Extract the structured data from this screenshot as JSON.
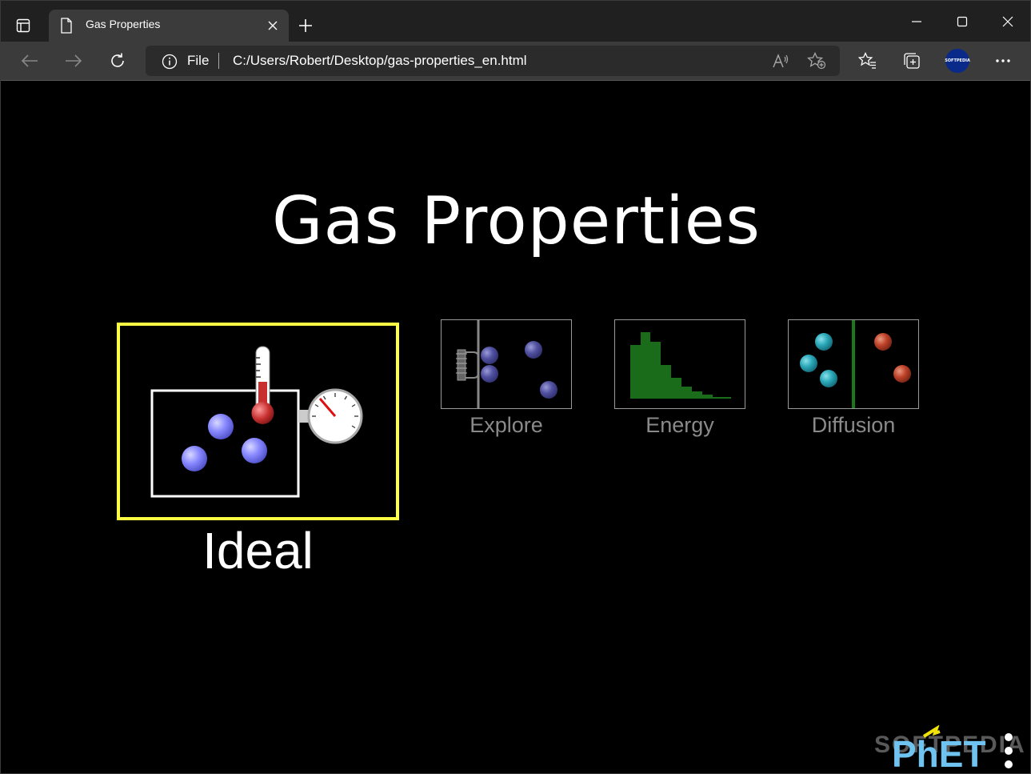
{
  "browser": {
    "tab_title": "Gas Properties",
    "address_prefix": "File",
    "url": "C:/Users/Robert/Desktop/gas-properties_en.html",
    "profile_label": "SOFTPEDIA"
  },
  "sim": {
    "title": "Gas Properties",
    "screens": [
      {
        "label": "Ideal",
        "selected": true
      },
      {
        "label": "Explore",
        "selected": false
      },
      {
        "label": "Energy",
        "selected": false
      },
      {
        "label": "Diffusion",
        "selected": false
      }
    ],
    "logo_text": "PhET",
    "watermark": "SOFTPEDIA"
  },
  "colors": {
    "selection_border": "#ffff44",
    "particle_heavy": "#8888ff",
    "histogram": "#1a6b1a",
    "particle_cyan": "#2aa8b8",
    "particle_red": "#c0432a",
    "phet_blue": "#6fc3f0",
    "phet_yellow": "#f2e20a"
  }
}
